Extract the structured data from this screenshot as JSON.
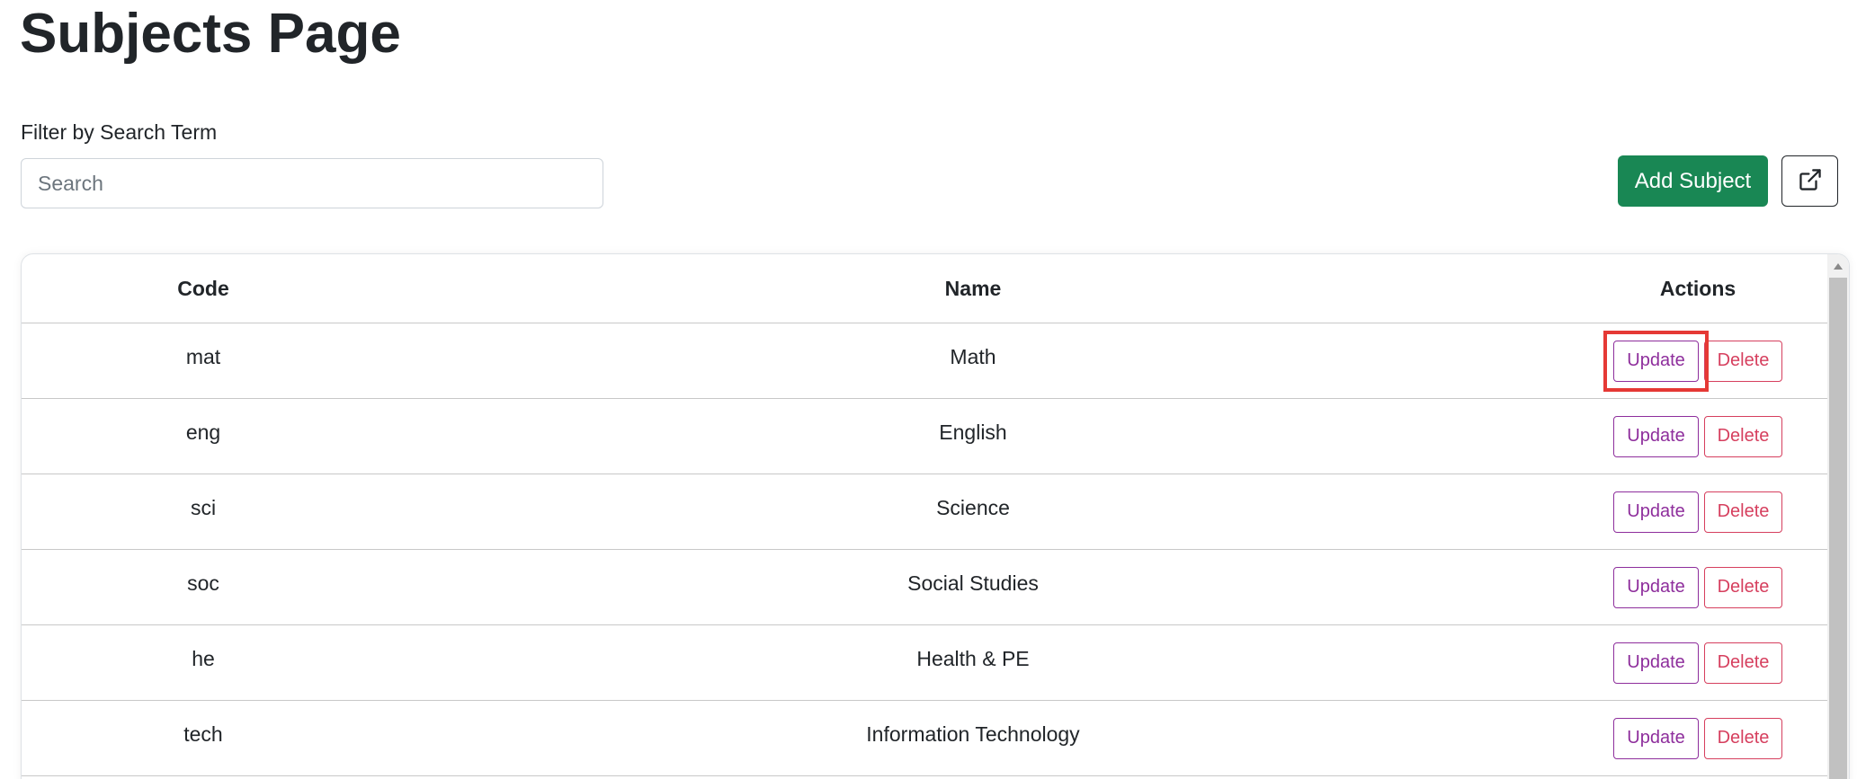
{
  "page": {
    "title": "Subjects Page"
  },
  "filter": {
    "label": "Filter by Search Term",
    "placeholder": "Search",
    "value": ""
  },
  "toolbar": {
    "add_label": "Add Subject",
    "export_icon": "external-link-icon"
  },
  "table": {
    "headers": {
      "code": "Code",
      "name": "Name",
      "actions": "Actions"
    },
    "update_label": "Update",
    "delete_label": "Delete",
    "rows": [
      {
        "code": "mat",
        "name": "Math"
      },
      {
        "code": "eng",
        "name": "English"
      },
      {
        "code": "sci",
        "name": "Science"
      },
      {
        "code": "soc",
        "name": "Social Studies"
      },
      {
        "code": "he",
        "name": "Health & PE"
      },
      {
        "code": "tech",
        "name": "Information Technology"
      }
    ]
  },
  "colors": {
    "add_button": "#198754",
    "update_outline": "#8e2e9c",
    "delete_outline": "#d63f5e",
    "highlight": "#e53935"
  }
}
